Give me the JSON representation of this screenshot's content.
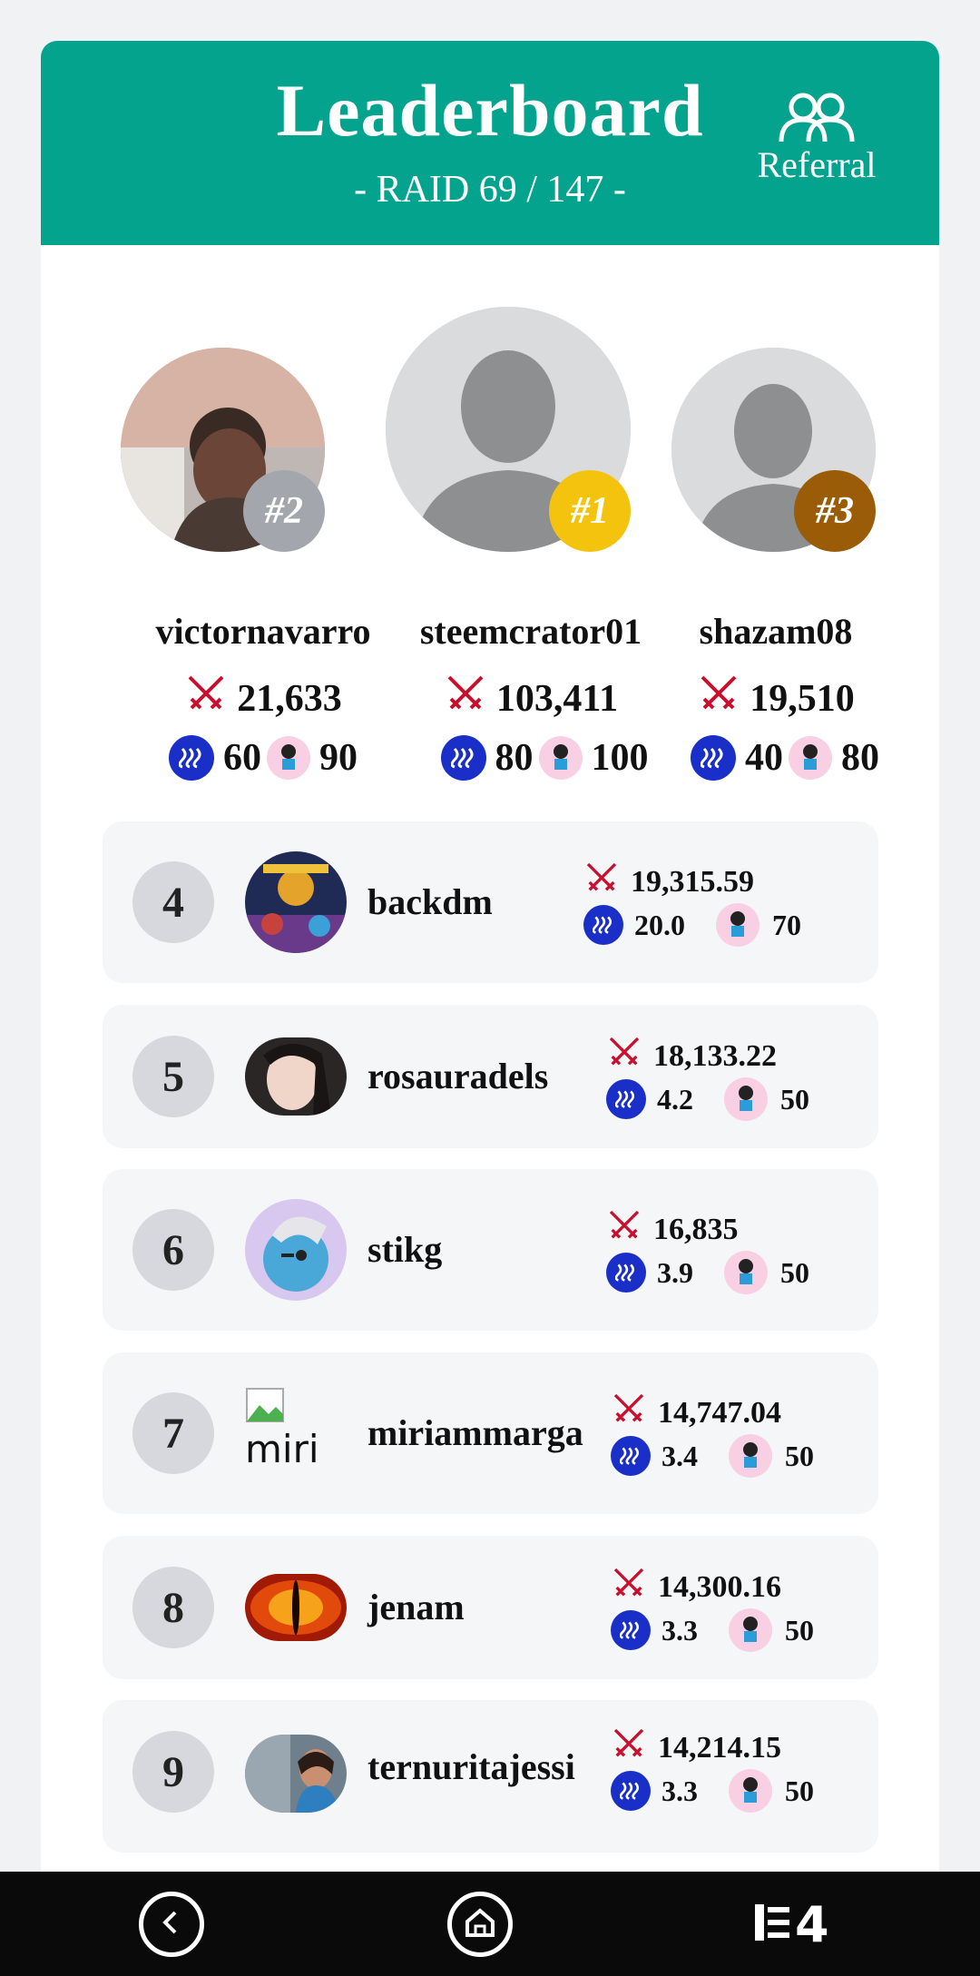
{
  "header": {
    "title": "Leaderboard",
    "subtitle": "- RAID 69 / 147 -",
    "referral_label": "Referral"
  },
  "podium": [
    {
      "rank_label": "#2",
      "name": "victornavarro",
      "score": "21,633",
      "steem": "60",
      "pet": "90",
      "badge_color": "#a3a7ad"
    },
    {
      "rank_label": "#1",
      "name": "steemcrator01",
      "score": "103,411",
      "steem": "80",
      "pet": "100",
      "badge_color": "#f4c30e"
    },
    {
      "rank_label": "#3",
      "name": "shazam08",
      "score": "19,510",
      "steem": "40",
      "pet": "80",
      "badge_color": "#9a5c06"
    }
  ],
  "rows": [
    {
      "rank": "4",
      "name": "backdm",
      "score": "19,315.59",
      "steem": "20.0",
      "pet": "70"
    },
    {
      "rank": "5",
      "name": "rosauradels",
      "score": "18,133.22",
      "steem": "4.2",
      "pet": "50"
    },
    {
      "rank": "6",
      "name": "stikg",
      "score": "16,835",
      "steem": "3.9",
      "pet": "50"
    },
    {
      "rank": "7",
      "name": "miriammarga",
      "avatar_alt": "miri",
      "score": "14,747.04",
      "steem": "3.4",
      "pet": "50"
    },
    {
      "rank": "8",
      "name": "jenam",
      "score": "14,300.16",
      "steem": "3.3",
      "pet": "50"
    },
    {
      "rank": "9",
      "name": "ternuritajessi",
      "score": "14,214.15",
      "steem": "3.3",
      "pet": "50"
    }
  ],
  "nav": {
    "right_label": "4"
  },
  "colors": {
    "header": "#03a38e",
    "steem": "#1a2fc7",
    "swords": "#c8102e"
  },
  "icons": [
    "referral-icon",
    "swords-icon",
    "steem-icon",
    "pet-icon",
    "back-icon",
    "home-icon",
    "recent-apps-icon"
  ]
}
